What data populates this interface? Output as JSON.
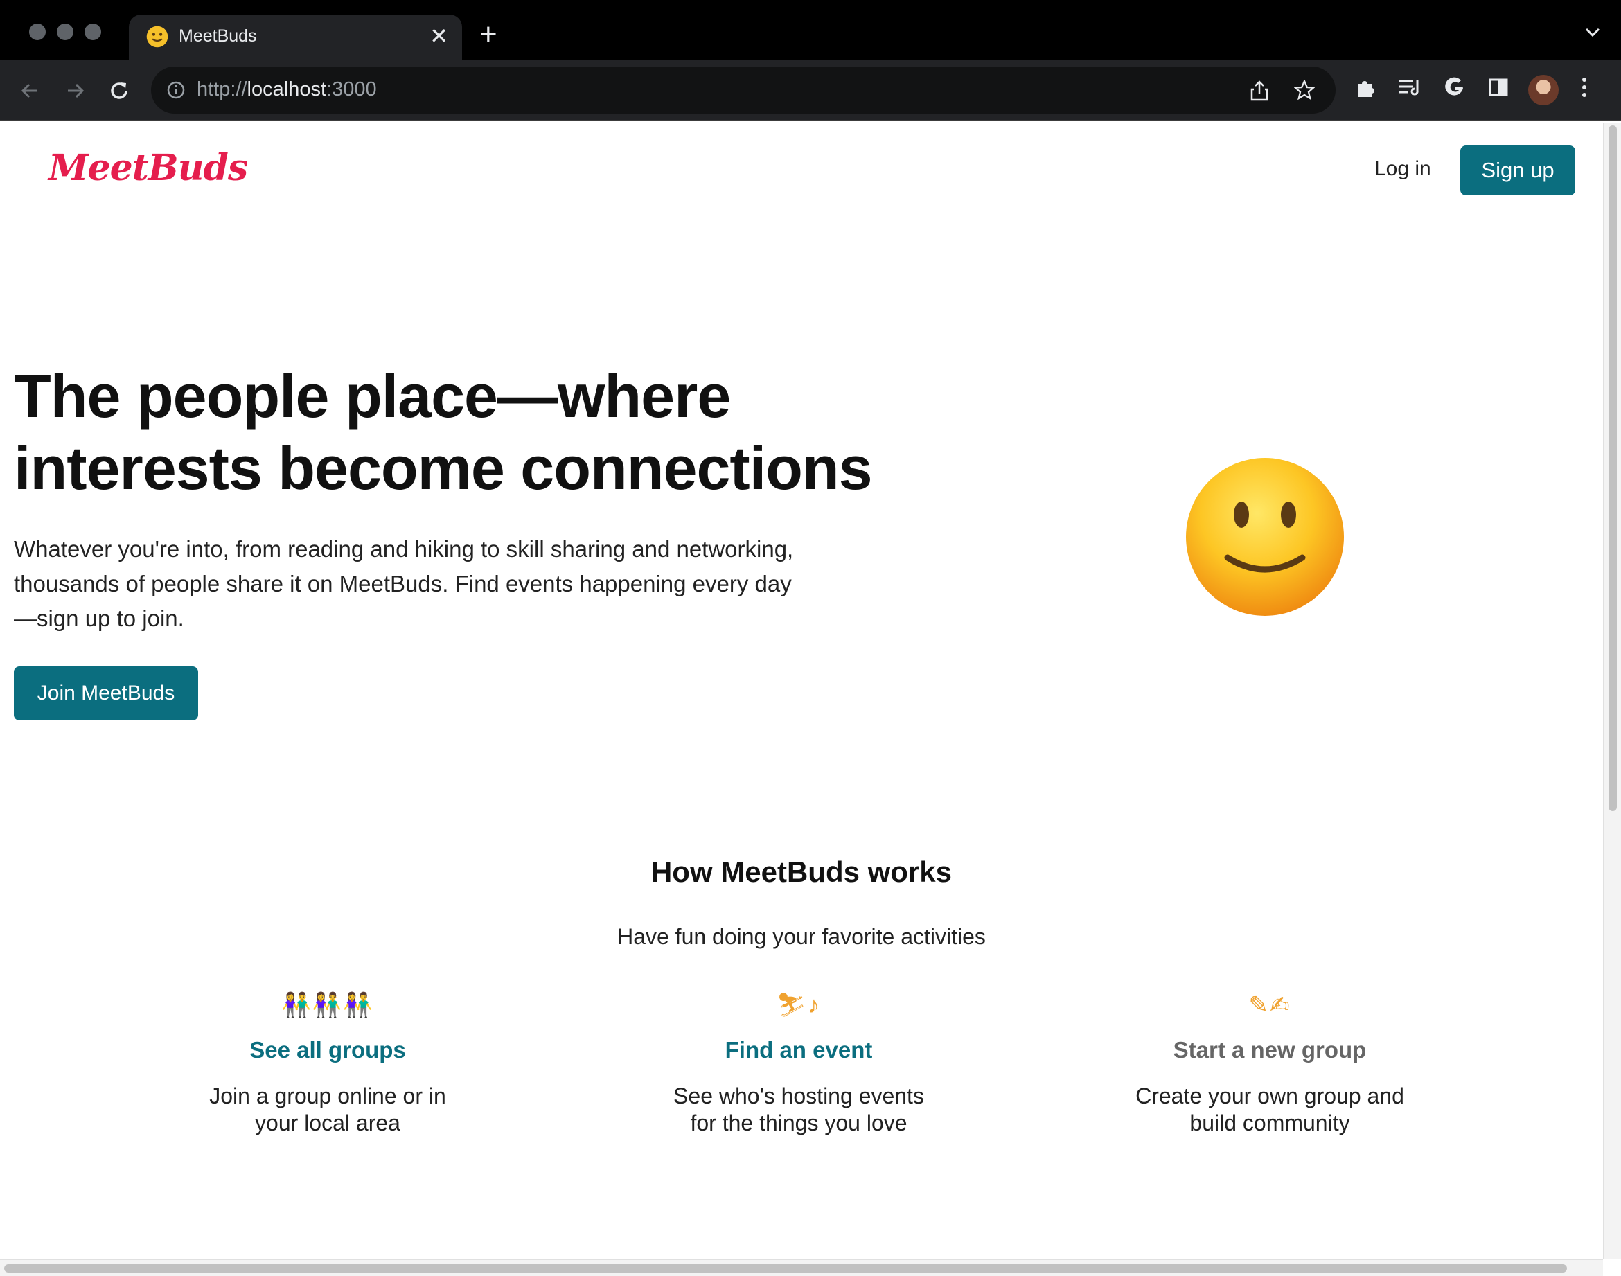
{
  "browser": {
    "tab_title": "MeetBuds",
    "url_scheme": "http://",
    "url_host": "localhost",
    "url_port": ":3000",
    "tab_close": "✕",
    "new_tab": "+"
  },
  "nav": {
    "logo": "MeetBuds",
    "login_label": "Log in",
    "signup_label": "Sign up"
  },
  "hero": {
    "title_line1": "The people place—where",
    "title_line2": "interests become connections",
    "text_line1": "Whatever you're into, from reading and hiking to skill sharing and networking,",
    "text_line2": "thousands of people share it on MeetBuds. Find events happening every day",
    "text_line3": "—sign up to join.",
    "cta_label": "Join MeetBuds"
  },
  "how": {
    "title": "How MeetBuds works",
    "subtitle": "Have fun doing your favorite activities",
    "cards": [
      {
        "icon": "people-group-icon",
        "glyph": "👫👫👫",
        "link": "See all groups",
        "text": "Join a group online or in your local area"
      },
      {
        "icon": "skier-music-icon",
        "glyph": "⛷♪",
        "link": "Find an event",
        "text": "See who's hosting events for the things you love"
      },
      {
        "icon": "pencil-signature-icon",
        "glyph": "✎✍",
        "link": "Start a new group",
        "text": "Create your own group and build community"
      }
    ]
  },
  "colors": {
    "brand": "#e51e4d",
    "primary": "#0b6e7f",
    "icon_accent": "#f0a22f"
  }
}
